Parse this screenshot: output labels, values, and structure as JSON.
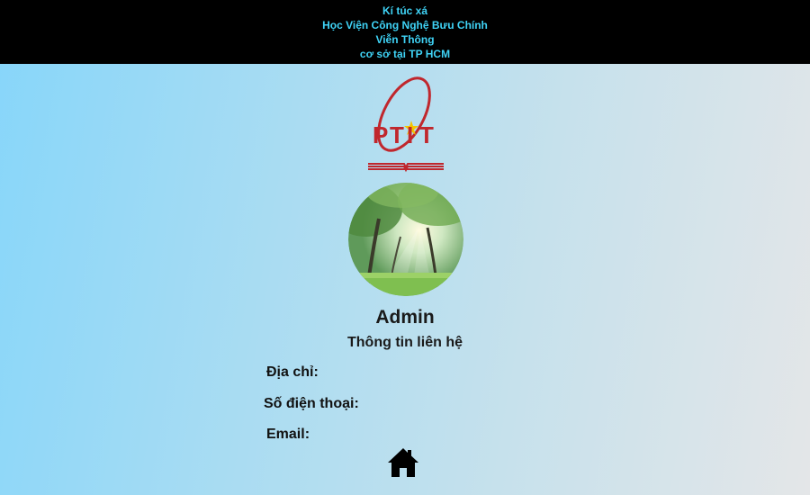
{
  "header": {
    "line1": "Kí túc xá",
    "line2": "Học Viện Công Nghệ Bưu Chính",
    "line3": "Viễn Thông",
    "line4": "cơ sở tại TP HCM"
  },
  "logo": {
    "text_p": "P",
    "text_t1": "T",
    "text_i": "I",
    "text_t2": "T"
  },
  "profile": {
    "name": "Admin",
    "subtitle": "Thông tin liên hệ",
    "address_label": "Địa chỉ:",
    "phone_label": "Số điện thoại:",
    "email_label": "Email:"
  },
  "icons": {
    "home": "home-icon"
  },
  "colors": {
    "header_bg": "#000000",
    "header_text": "#3fd3f6",
    "logo_red": "#c0272d",
    "logo_star": "#f5c400"
  }
}
